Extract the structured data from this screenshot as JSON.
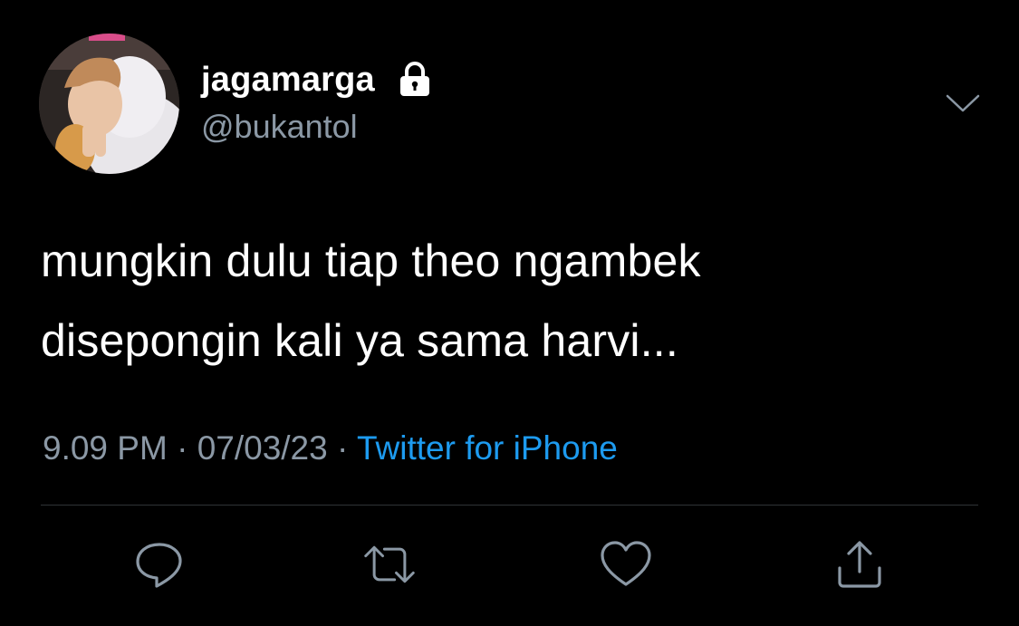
{
  "user": {
    "display_name": "jagamarga",
    "handle": "@bukantol",
    "protected_icon": "lock-icon",
    "avatar_icon": "profile-photo"
  },
  "tweet": {
    "lines": [
      "mungkin dulu tiap theo ngambek",
      "disepongin kali ya sama harvi..."
    ]
  },
  "meta": {
    "time": "9.09 PM",
    "separator": "·",
    "date": "07/03/23",
    "source": "Twitter for iPhone"
  },
  "actions": [
    {
      "name": "reply",
      "icon": "reply-icon"
    },
    {
      "name": "retweet",
      "icon": "retweet-icon"
    },
    {
      "name": "like",
      "icon": "heart-icon"
    },
    {
      "name": "share",
      "icon": "share-icon"
    }
  ],
  "colors": {
    "background": "#000000",
    "text_primary": "#ffffff",
    "text_secondary": "#8b98a5",
    "link": "#1d9bf0",
    "divider": "#2f3336"
  }
}
